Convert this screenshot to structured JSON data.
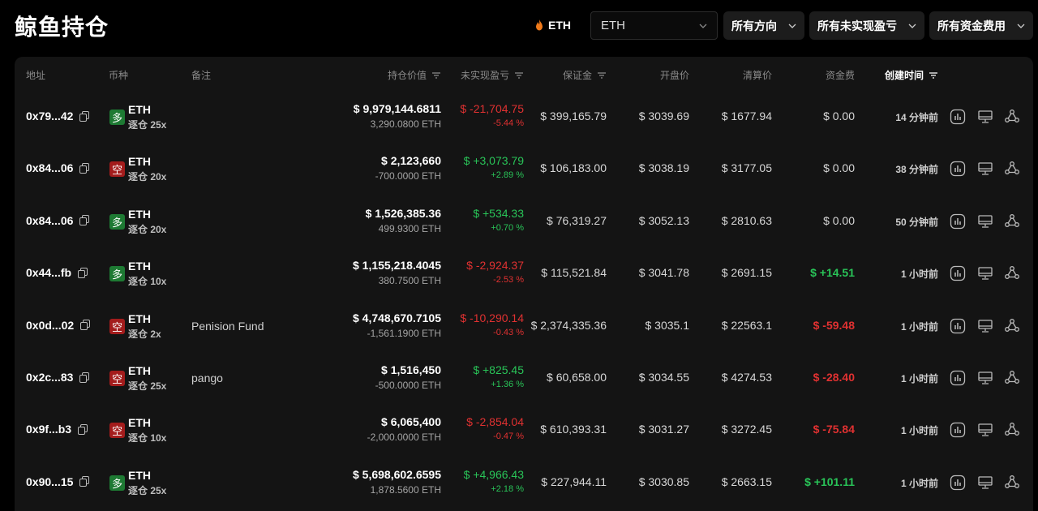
{
  "header": {
    "title": "鲸鱼持仓",
    "coin_label": "ETH",
    "coin_select_value": "ETH",
    "filters": [
      "所有方向",
      "所有未实现盈亏",
      "所有资金费用"
    ]
  },
  "table": {
    "columns": {
      "address": "地址",
      "coin": "币种",
      "note": "备注",
      "position_value": "持仓价值",
      "unrealized_pnl": "未实现盈亏",
      "margin": "保证金",
      "open_price": "开盘价",
      "liq_price": "清算价",
      "funding": "资金费",
      "created": "创建时间"
    },
    "rows": [
      {
        "address": "0x79...42",
        "side": "多",
        "side_type": "long",
        "coin": "ETH",
        "leverage": "逐仓 25x",
        "note": "",
        "value": "$ 9,979,144.6811",
        "qty": "3,290.0800 ETH",
        "pnl": "$ -21,704.75",
        "pnl_pct": "-5.44 %",
        "pnl_sign": "neg",
        "margin": "$ 399,165.79",
        "open": "$ 3039.69",
        "liq": "$ 1677.94",
        "funding": "$ 0.00",
        "funding_sign": "zero",
        "time": "14 分钟前"
      },
      {
        "address": "0x84...06",
        "side": "空",
        "side_type": "short",
        "coin": "ETH",
        "leverage": "逐仓 20x",
        "note": "",
        "value": "$ 2,123,660",
        "qty": "-700.0000 ETH",
        "pnl": "$ +3,073.79",
        "pnl_pct": "+2.89 %",
        "pnl_sign": "pos",
        "margin": "$ 106,183.00",
        "open": "$ 3038.19",
        "liq": "$ 3177.05",
        "funding": "$ 0.00",
        "funding_sign": "zero",
        "time": "38 分钟前"
      },
      {
        "address": "0x84...06",
        "side": "多",
        "side_type": "long",
        "coin": "ETH",
        "leverage": "逐仓 20x",
        "note": "",
        "value": "$ 1,526,385.36",
        "qty": "499.9300 ETH",
        "pnl": "$ +534.33",
        "pnl_pct": "+0.70 %",
        "pnl_sign": "pos",
        "margin": "$ 76,319.27",
        "open": "$ 3052.13",
        "liq": "$ 2810.63",
        "funding": "$ 0.00",
        "funding_sign": "zero",
        "time": "50 分钟前"
      },
      {
        "address": "0x44...fb",
        "side": "多",
        "side_type": "long",
        "coin": "ETH",
        "leverage": "逐仓 10x",
        "note": "",
        "value": "$ 1,155,218.4045",
        "qty": "380.7500 ETH",
        "pnl": "$ -2,924.37",
        "pnl_pct": "-2.53 %",
        "pnl_sign": "neg",
        "margin": "$ 115,521.84",
        "open": "$ 3041.78",
        "liq": "$ 2691.15",
        "funding": "$ +14.51",
        "funding_sign": "pos",
        "time": "1 小时前"
      },
      {
        "address": "0x0d...02",
        "side": "空",
        "side_type": "short",
        "coin": "ETH",
        "leverage": "逐仓 2x",
        "note": "Penision Fund",
        "value": "$ 4,748,670.7105",
        "qty": "-1,561.1900 ETH",
        "pnl": "$ -10,290.14",
        "pnl_pct": "-0.43 %",
        "pnl_sign": "neg",
        "margin": "$ 2,374,335.36",
        "open": "$ 3035.1",
        "liq": "$ 22563.1",
        "funding": "$ -59.48",
        "funding_sign": "neg",
        "time": "1 小时前"
      },
      {
        "address": "0x2c...83",
        "side": "空",
        "side_type": "short",
        "coin": "ETH",
        "leverage": "逐仓 25x",
        "note": "pango",
        "value": "$ 1,516,450",
        "qty": "-500.0000 ETH",
        "pnl": "$ +825.45",
        "pnl_pct": "+1.36 %",
        "pnl_sign": "pos",
        "margin": "$ 60,658.00",
        "open": "$ 3034.55",
        "liq": "$ 4274.53",
        "funding": "$ -28.40",
        "funding_sign": "neg",
        "time": "1 小时前"
      },
      {
        "address": "0x9f...b3",
        "side": "空",
        "side_type": "short",
        "coin": "ETH",
        "leverage": "逐仓 10x",
        "note": "",
        "value": "$ 6,065,400",
        "qty": "-2,000.0000 ETH",
        "pnl": "$ -2,854.04",
        "pnl_pct": "-0.47 %",
        "pnl_sign": "neg",
        "margin": "$ 610,393.31",
        "open": "$ 3031.27",
        "liq": "$ 3272.45",
        "funding": "$ -75.84",
        "funding_sign": "neg",
        "time": "1 小时前"
      },
      {
        "address": "0x90...15",
        "side": "多",
        "side_type": "long",
        "coin": "ETH",
        "leverage": "逐仓 25x",
        "note": "",
        "value": "$ 5,698,602.6595",
        "qty": "1,878.5600 ETH",
        "pnl": "$ +4,966.43",
        "pnl_pct": "+2.18 %",
        "pnl_sign": "pos",
        "margin": "$ 227,944.11",
        "open": "$ 3030.85",
        "liq": "$ 2663.15",
        "funding": "$ +101.11",
        "funding_sign": "pos",
        "time": "1 小时前"
      }
    ]
  },
  "colors": {
    "positive": "#29c458",
    "negative": "#e03131",
    "long_badge": "#1e7a33",
    "short_badge": "#a31c1c",
    "flame": "#f07a1a"
  },
  "icons": [
    "flame-icon",
    "chevron-down-icon",
    "sort-icon",
    "copy-icon",
    "chart-icon",
    "monitor-icon",
    "share-nodes-icon"
  ]
}
